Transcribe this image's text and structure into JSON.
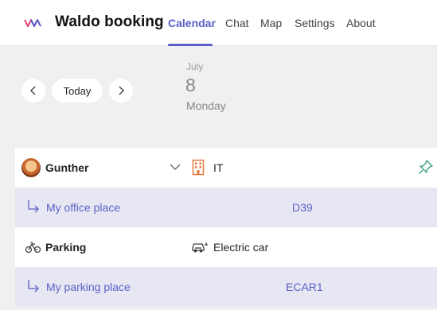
{
  "app": {
    "title": "Waldo booking",
    "logo_icon": "waldo-logo-icon",
    "accent_color": "#5b5fc7"
  },
  "tabs": [
    {
      "label": "Calendar",
      "active": true
    },
    {
      "label": "Chat",
      "active": false
    },
    {
      "label": "Map",
      "active": false
    },
    {
      "label": "Settings",
      "active": false
    },
    {
      "label": "About",
      "active": false
    }
  ],
  "date_nav": {
    "today_label": "Today",
    "prev_icon": "chevron-left-icon",
    "next_icon": "chevron-right-icon",
    "month": "July",
    "day": "8",
    "weekday": "Monday"
  },
  "bookings": [
    {
      "person": "Gunther",
      "expand_icon": "chevron-down-icon",
      "building_icon": "office-building-icon",
      "department": "IT",
      "pin_icon": "pin-icon",
      "sub_label": "My office place",
      "sub_value": "D39"
    },
    {
      "category": "Parking",
      "category_icon": "bicycle-icon",
      "vehicle_icon": "electric-car-icon",
      "vehicle": "Electric car",
      "sub_label": "My parking place",
      "sub_value": "ECAR1"
    }
  ]
}
